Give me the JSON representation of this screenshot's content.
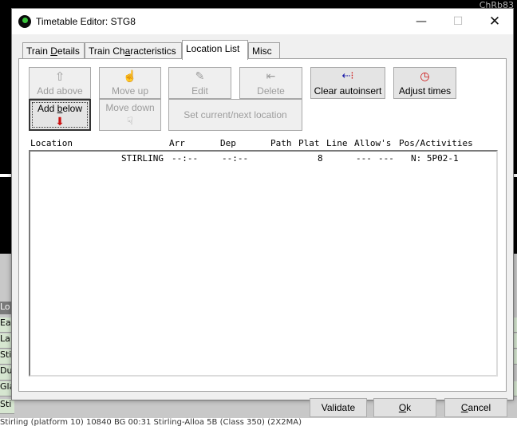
{
  "window": {
    "title": "Timetable Editor: STG8",
    "min_glyph": "—",
    "max_glyph": "☐",
    "close_glyph": "✕"
  },
  "background": {
    "top_right_text": "ChRb83",
    "row_labels": [
      "Lo",
      "Ea",
      "La",
      "Sti",
      "Du",
      "Gla",
      "Sti"
    ],
    "bottom_text": "Stirling (platform 10)        10840      BG       00:31 Stirling-Alloa 5B (Class 350) (2X2MA)"
  },
  "tabs": [
    {
      "label_pre": "Train ",
      "label_u": "D",
      "label_post": "etails"
    },
    {
      "label_pre": "Train Ch",
      "label_u": "a",
      "label_post": "racteristics"
    },
    {
      "label_pre": "Location List",
      "label_u": "",
      "label_post": ""
    },
    {
      "label_pre": "Misc",
      "label_u": "",
      "label_post": ""
    }
  ],
  "toolbar": {
    "add_above": "Add above",
    "move_up": "Move up",
    "edit": "Edit",
    "delete": "Delete",
    "clear_autoinsert": "Clear autoinsert",
    "adjust_times": "Adjust times",
    "add_below_pre": "Add ",
    "add_below_u": "b",
    "add_below_post": "elow",
    "move_down": "Move down",
    "set_current": "Set current/next location"
  },
  "list": {
    "columns": [
      "Location",
      "Arr",
      "Dep",
      "Path",
      "Plat",
      "Line",
      "Allow's",
      "Pos/Activities"
    ],
    "rows": [
      {
        "location": "STIRLING",
        "arr": "--:--",
        "dep": "--:--",
        "path": "",
        "plat": "8",
        "line": "",
        "allow1": "---",
        "allow2": "---",
        "pos": "N: 5P02-1"
      }
    ]
  },
  "footer": {
    "validate": "Validate",
    "ok_u": "O",
    "ok_post": "k",
    "cancel_u": "C",
    "cancel_post": "ancel"
  },
  "colors": {
    "accent_red": "#cc1111",
    "accent_blue": "#1a1aa8",
    "icon_green": "#39c43a"
  }
}
